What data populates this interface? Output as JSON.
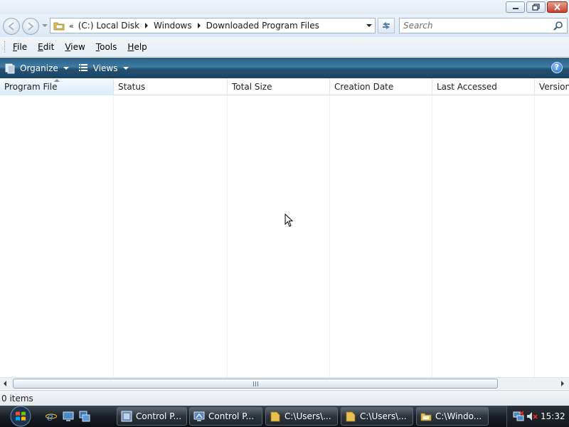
{
  "window": {
    "buttons": {
      "minimize_icon": "minimize-icon",
      "maximize_icon": "restore-icon",
      "close_icon": "close-icon"
    }
  },
  "address": {
    "overflow_chevron": "«",
    "crumbs": [
      "(C:) Local Disk",
      "Windows",
      "Downloaded Program Files"
    ],
    "search_placeholder": "Search"
  },
  "menu": {
    "items": [
      {
        "accel": "F",
        "rest": "ile"
      },
      {
        "accel": "E",
        "rest": "dit"
      },
      {
        "accel": "V",
        "rest": "iew"
      },
      {
        "accel": "T",
        "rest": "ools"
      },
      {
        "accel": "H",
        "rest": "elp"
      }
    ]
  },
  "commandbar": {
    "organize_label": "Organize",
    "views_label": "Views",
    "help_glyph": "?",
    "bar_color": "#2c5f87"
  },
  "columns": [
    "Program File",
    "Status",
    "Total Size",
    "Creation Date",
    "Last Accessed",
    "Version"
  ],
  "status": {
    "items_text": "0 items"
  },
  "taskbar": {
    "buttons": [
      {
        "label": "Control P...",
        "icon": "control-panel-icon"
      },
      {
        "label": "Control P...",
        "icon": "control-panel-icon"
      },
      {
        "label": "C:\\Users\\...",
        "icon": "folder-icon"
      },
      {
        "label": "C:\\Users\\...",
        "icon": "folder-icon"
      },
      {
        "label": "C:\\Windo...",
        "icon": "folder-icon"
      }
    ],
    "clock": "15:32"
  }
}
